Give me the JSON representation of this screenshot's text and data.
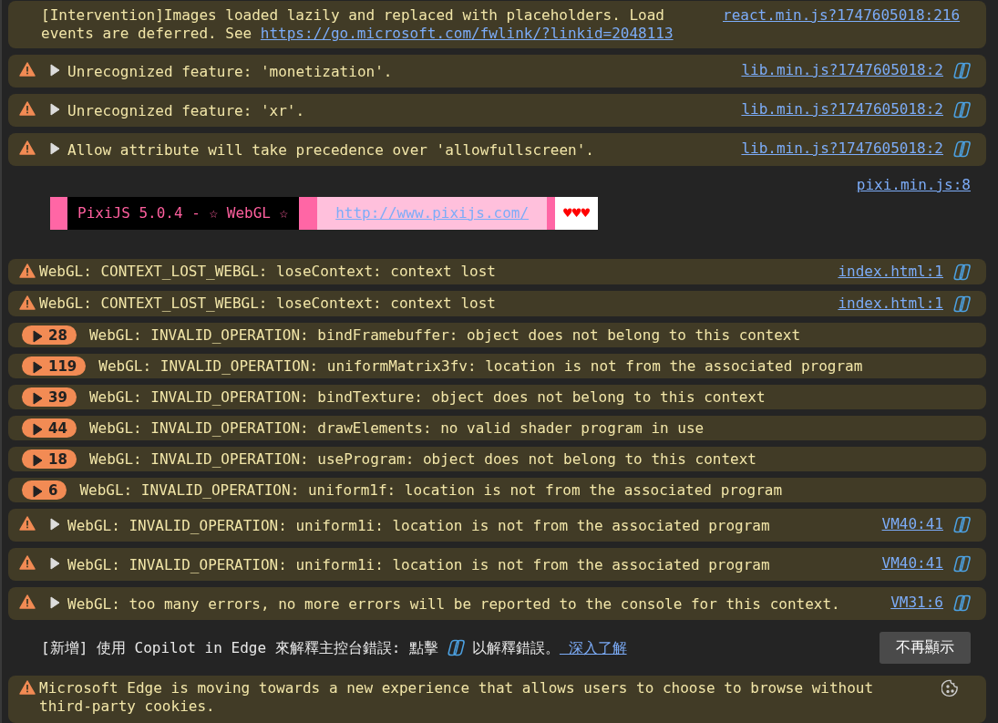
{
  "messages": [
    {
      "kind": "intervention",
      "text": "[Intervention]Images loaded lazily and replaced with placeholders. Load events are deferred. See ",
      "link": "https://go.microsoft.com/fwlink/?linkid=2048113",
      "source": "react.min.js?1747605018:216"
    },
    {
      "kind": "warning",
      "expanded": false,
      "text": "Unrecognized feature: 'monetization'.",
      "source": "lib.min.js?1747605018:2",
      "copilot": true
    },
    {
      "kind": "warning",
      "expanded": false,
      "text": "Unrecognized feature: 'xr'.",
      "source": "lib.min.js?1747605018:2",
      "copilot": true
    },
    {
      "kind": "warning",
      "expanded": false,
      "text": "Allow attribute will take precedence over 'allowfullscreen'.",
      "source": "lib.min.js?1747605018:2",
      "copilot": true
    },
    {
      "kind": "pixi",
      "title": "PixiJS 5.0.4 - ☆ WebGL ☆",
      "url": "http://www.pixijs.com/",
      "hearts": "♥♥♥",
      "source": "pixi.min.js:8"
    },
    {
      "kind": "compact",
      "text": "WebGL: CONTEXT_LOST_WEBGL: loseContext: context lost",
      "source": "index.html:1",
      "copilot": true
    },
    {
      "kind": "compact",
      "text": "WebGL: CONTEXT_LOST_WEBGL: loseContext: context lost",
      "source": "index.html:1",
      "copilot": true
    },
    {
      "kind": "group",
      "expanded": false,
      "count": "28",
      "text": "WebGL: INVALID_OPERATION: bindFramebuffer: object does not belong to this context"
    },
    {
      "kind": "group",
      "expanded": false,
      "count": "119",
      "text": "WebGL: INVALID_OPERATION: uniformMatrix3fv: location is not from the associated program"
    },
    {
      "kind": "group",
      "expanded": false,
      "count": "39",
      "text": "WebGL: INVALID_OPERATION: bindTexture: object does not belong to this context"
    },
    {
      "kind": "group",
      "expanded": false,
      "count": "44",
      "text": "WebGL: INVALID_OPERATION: drawElements: no valid shader program in use"
    },
    {
      "kind": "group",
      "expanded": false,
      "count": "18",
      "text": "WebGL: INVALID_OPERATION: useProgram: object does not belong to this context"
    },
    {
      "kind": "group",
      "expanded": false,
      "count": "6",
      "text": "WebGL: INVALID_OPERATION: uniform1f: location is not from the associated program"
    },
    {
      "kind": "warning",
      "expanded": false,
      "text": "WebGL: INVALID_OPERATION: uniform1i: location is not from the associated program",
      "source": "VM40:41",
      "copilot": true
    },
    {
      "kind": "warning",
      "expanded": false,
      "text": "WebGL: INVALID_OPERATION: uniform1i: location is not from the associated program",
      "source": "VM40:41",
      "copilot": true
    },
    {
      "kind": "warning",
      "expanded": false,
      "text": "WebGL: too many errors, no more errors will be reported to the console for this context.",
      "source": "VM31:6",
      "copilot": true
    },
    {
      "kind": "tip",
      "before": "[新增] 使用 Copilot in Edge 來解釋主控台錯誤: 點擊",
      "after": "以解釋錯誤。",
      "link": " 深入了解",
      "button": "不再顯示"
    },
    {
      "kind": "notice",
      "text": "Microsoft Edge is moving towards a new experience that allows users to choose to browse without third-party cookies."
    }
  ]
}
